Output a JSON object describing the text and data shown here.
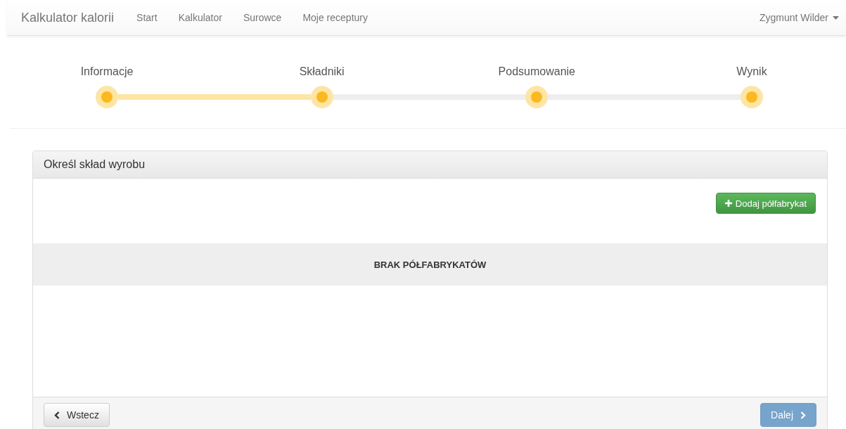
{
  "navbar": {
    "brand": "Kalkulator kalorii",
    "links": [
      {
        "label": "Start"
      },
      {
        "label": "Kalkulator"
      },
      {
        "label": "Surowce"
      },
      {
        "label": "Moje receptury"
      }
    ],
    "user": "Zygmunt Wilder"
  },
  "wizard": {
    "connectors": [
      {
        "filled": true
      },
      {
        "filled": false
      },
      {
        "filled": false
      }
    ],
    "steps": [
      {
        "label": "Informacje"
      },
      {
        "label": "Składniki"
      },
      {
        "label": "Podsumowanie"
      },
      {
        "label": "Wynik"
      }
    ]
  },
  "panel": {
    "title": "Określ skład wyrobu",
    "add_button": "Dodaj półfabrykat",
    "empty_message": "BRAK PÓŁFABRYKATÓW",
    "back_button": {
      "label": "Wstecz",
      "disabled": false
    },
    "next_button": {
      "label": "Dalej",
      "disabled": true
    }
  }
}
